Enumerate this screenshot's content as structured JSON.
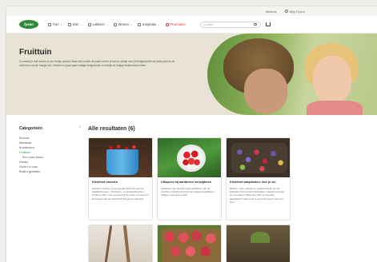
{
  "utility": {
    "links": [
      "Winkels",
      "Mijn Fyxeo"
    ]
  },
  "brand": {
    "logo_text": "fyxeo"
  },
  "nav": {
    "items": [
      {
        "label": "Tuin",
        "icon": "leaf-icon"
      },
      {
        "label": "Dier",
        "icon": "paw-icon"
      },
      {
        "label": "Lekkers",
        "icon": "gift-icon"
      },
      {
        "label": "Wonen",
        "icon": "home-icon"
      },
      {
        "label": "Inspiratie",
        "icon": "bulb-icon"
      },
      {
        "label": "Promoties",
        "icon": "percent-icon",
        "promo": true
      }
    ],
    "search_placeholder": "Zoeken"
  },
  "hero": {
    "title": "Fruittuin",
    "description": "Zo kweek je fruit bomen in een fruitig verhaal. Maar niet zonder de juiste voet in je tuin en plekje voor je fruitgeest.Met de juiste plek en de volle kers van de fruitige tuin. Ontdek nu jouw eigen fruitige fruitgroenten en bekijk de fruitige fruitkweekvruchten."
  },
  "sidebar": {
    "title": "Categorieën",
    "items": [
      {
        "label": "Ecotuin"
      },
      {
        "label": "Moestuin"
      },
      {
        "label": "Kruidentuin"
      },
      {
        "label": "Fruittuin",
        "active": true
      },
      {
        "label": "Een rode saam",
        "sub": true
      },
      {
        "label": "Dieren"
      },
      {
        "label": "Groen in huis"
      },
      {
        "label": "Buiten genieten"
      }
    ]
  },
  "results": {
    "title": "Alle resultaten (6)",
    "cards": [
      {
        "title": "Kleinfruit snoeien",
        "text": "Kleinfruit snoeien is een goede toekomst voor de kwaliteit bessen - framboos - et struikenbrood en struikvruchten. Hoe vermoed jij het juiste moment om de bessen tak van kleinfruit? We geven wat tips!"
      },
      {
        "title": "Uitlopers bij aardbeien verwijderen",
        "text": "Aardbeien zijn heerlijk zodat aardbeien zijn de vruchten. Vanaf juni tot juli zijn uitlopers aardbeien uitlopen. Hoe doe je dat?"
      },
      {
        "title": "Kleinfruit aanplanten: doe je zo!",
        "text": "Bessen, rode, blauwe en zwarte bessen zijn de lekkerste fruit van de fruitstruiken. Hoewel een pluk om te kweken. Maar hoe plant je de juiste aanplanten? Hoe moet je een fruit doen? Lees het hier!"
      },
      {
        "title": "",
        "text": ""
      },
      {
        "title": "",
        "text": ""
      },
      {
        "title": "",
        "text": ""
      }
    ]
  }
}
